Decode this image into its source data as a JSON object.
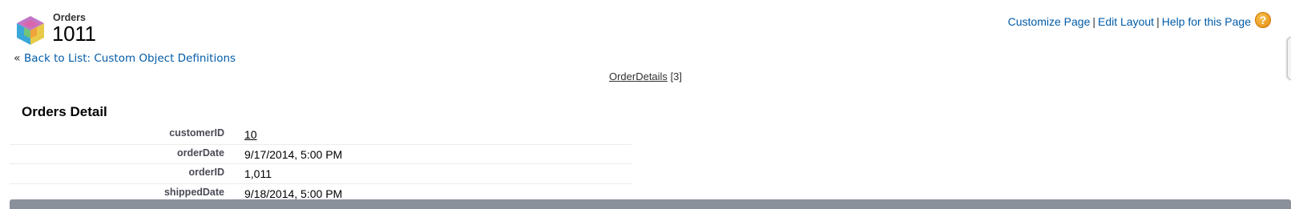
{
  "header": {
    "object_type": "Orders",
    "record_name": "1011",
    "icon": "orders-cube-icon"
  },
  "top_links": {
    "customize_page": "Customize Page",
    "edit_layout": "Edit Layout",
    "help_for_page": "Help for this Page",
    "separator": "|",
    "help_icon_glyph": "?"
  },
  "back_link": {
    "prefix": "«",
    "label": "Back to List: Custom Object Definitions"
  },
  "related_lists": {
    "label": "OrderDetails",
    "count": "[3]"
  },
  "detail": {
    "title": "Orders Detail",
    "fields": [
      {
        "label": "customerID",
        "value": "10"
      },
      {
        "label": "orderDate",
        "value": "9/17/2014, 5:00 PM"
      },
      {
        "label": "orderID",
        "value": "1,011"
      },
      {
        "label": "shippedDate",
        "value": "9/18/2014, 5:00 PM"
      }
    ]
  },
  "colors": {
    "link": "#015ba7",
    "label_text": "#4a4a56",
    "bottom_bar": "#8a919b",
    "help_icon": "#e8a12a"
  }
}
